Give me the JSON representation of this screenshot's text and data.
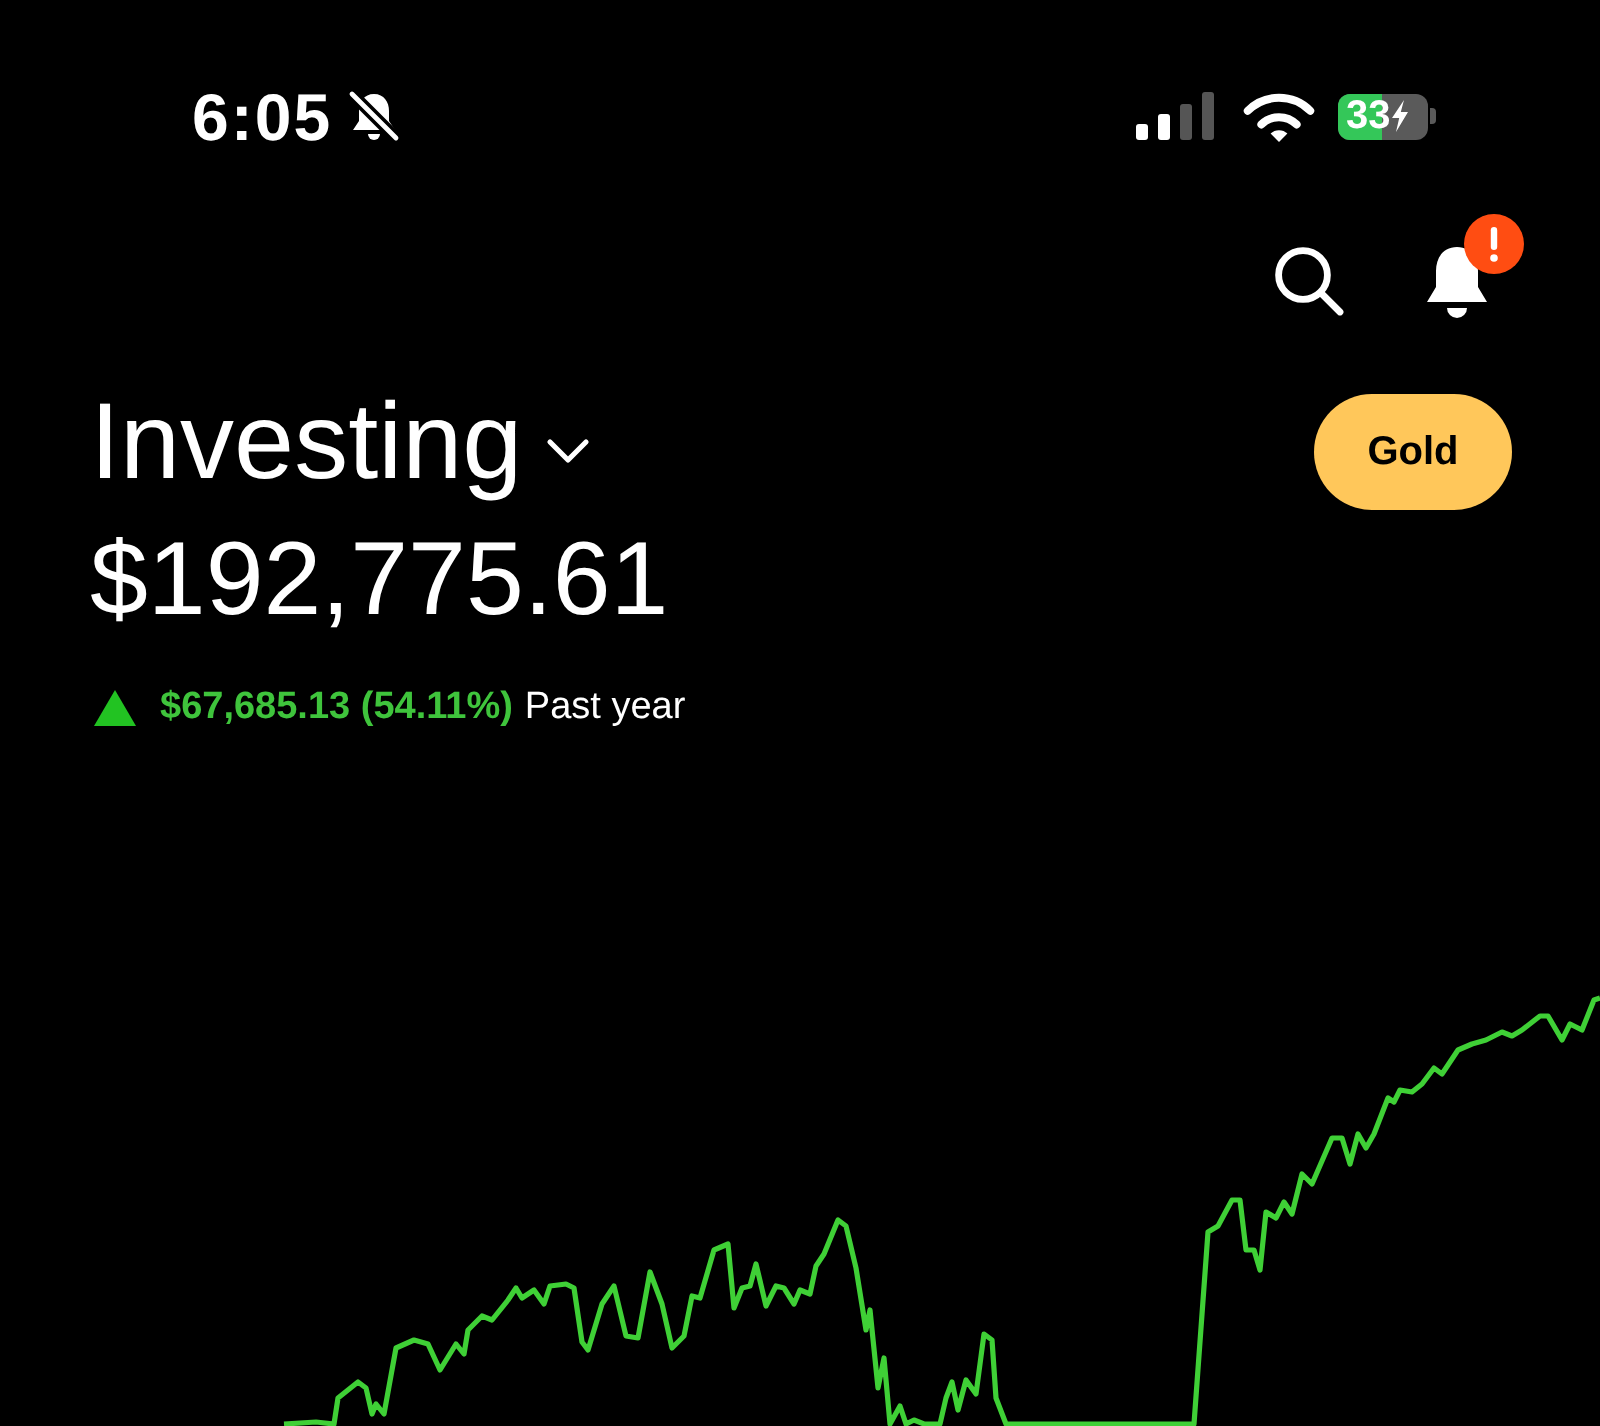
{
  "status_bar": {
    "time": "6:05",
    "silent": true,
    "battery_text": "33",
    "charging": true
  },
  "header": {
    "notification_alert": true
  },
  "portfolio": {
    "title": "Investing",
    "badge": "Gold",
    "value": "$192,775.61",
    "change": {
      "gain": true,
      "amount": "$67,685.13 (54.11%)",
      "period": "Past year"
    }
  }
}
